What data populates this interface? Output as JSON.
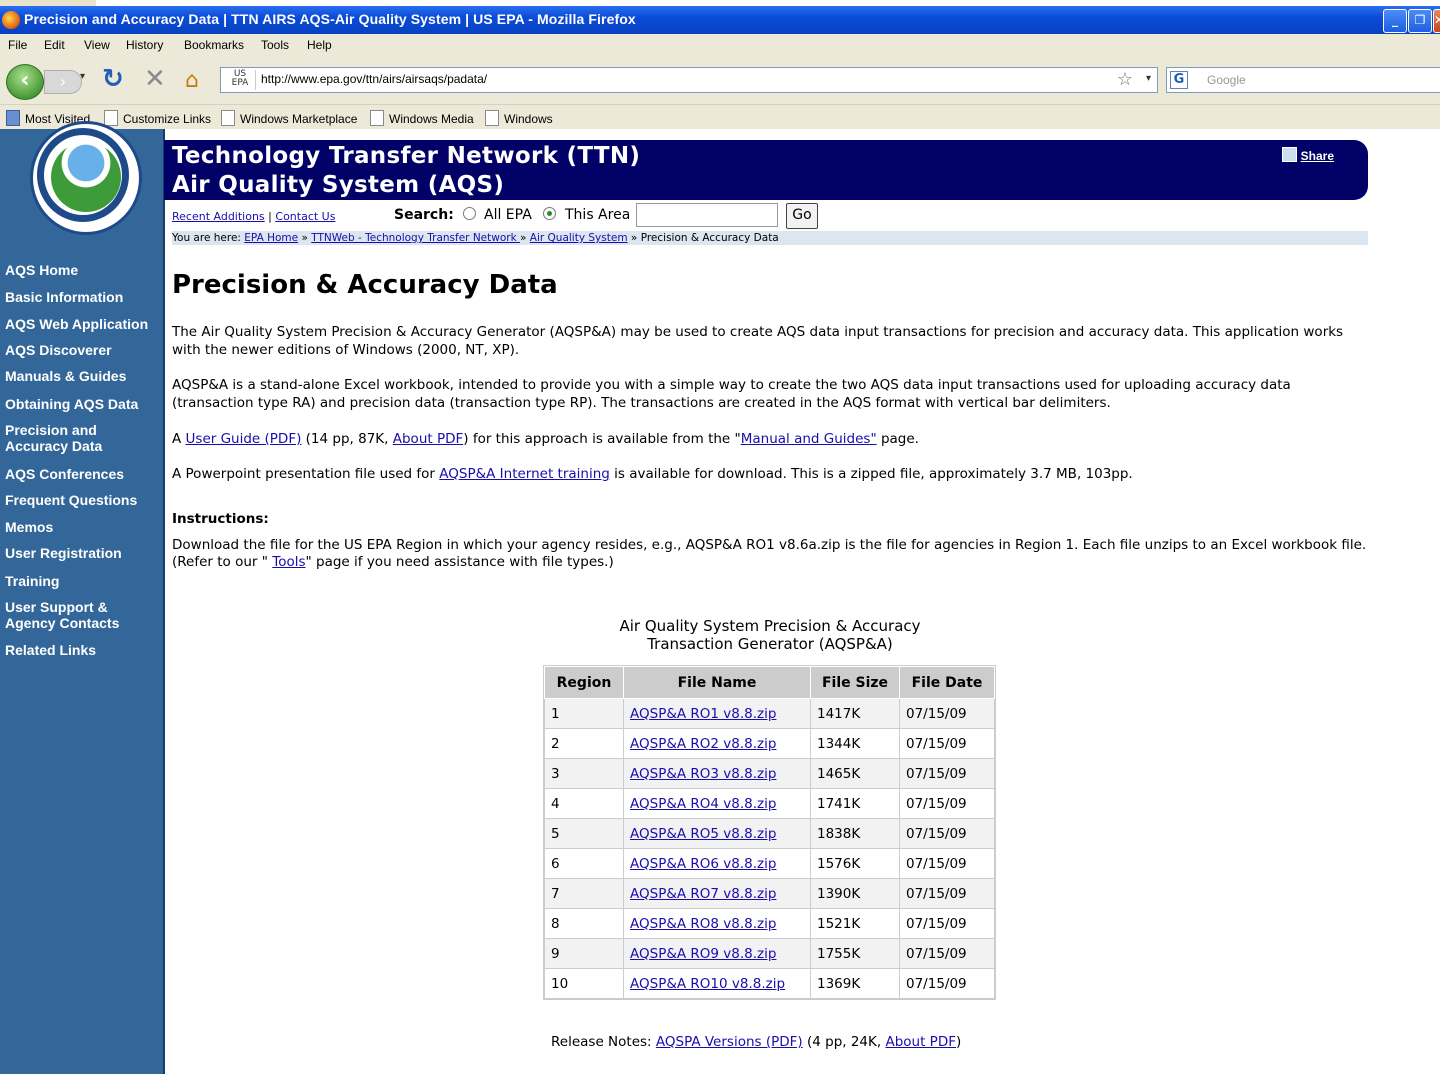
{
  "window": {
    "title": "Precision and Accuracy Data | TTN AIRS AQS-Air Quality System | US EPA - Mozilla Firefox",
    "buttons": [
      "_",
      "❐",
      "✕"
    ]
  },
  "menu": [
    "File",
    "Edit",
    "View",
    "History",
    "Bookmarks",
    "Tools",
    "Help"
  ],
  "nav": {
    "site_badge": "US EPA",
    "url": "http://www.epa.gov/ttn/airs/airsaqs/padata/",
    "search_placeholder": "Google"
  },
  "bookmarks": [
    "Most Visited",
    "Customize Links",
    "Windows Marketplace",
    "Windows Media",
    "Windows"
  ],
  "banner": {
    "line1": "Technology Transfer Network (TTN)",
    "line2": "Air Quality System (AQS)",
    "share": "Share"
  },
  "utility": {
    "recent_additions": "Recent Additions",
    "sep": "|",
    "contact_us": "Contact Us",
    "search_label": "Search:",
    "all_epa": "All EPA",
    "this_area": "This Area",
    "go": "Go"
  },
  "breadcrumb": {
    "prefix": "You are here:",
    "items": [
      "EPA Home",
      "TTNWeb - Technology Transfer Network ",
      "Air Quality System"
    ],
    "sep": "»",
    "current": "Precision & Accuracy Data"
  },
  "sidebar": {
    "items": [
      "AQS Home",
      "Basic Information",
      "AQS Web Application",
      "AQS Discoverer",
      "Manuals & Guides",
      "Obtaining AQS Data",
      "Precision and Accuracy Data",
      "AQS Conferences",
      "Frequent Questions",
      "Memos",
      "User Registration",
      "Training",
      "User Support & Agency Contacts",
      "Related Links"
    ]
  },
  "main": {
    "title": "Precision & Accuracy Data",
    "p1": "The Air Quality System Precision & Accuracy Generator (AQSP&A) may be used to create AQS data input transactions for precision and accuracy data. This application works with the newer editions of Windows (2000, NT, XP).",
    "p2": "AQSP&A is a stand-alone Excel workbook, intended to provide you with a simple way to create the two AQS data input transactions used for uploading accuracy data (transaction type RA) and precision data (transaction type RP). The transactions are created in the AQS format with vertical bar delimiters.",
    "p3": {
      "a": "A ",
      "link1": "User Guide (PDF)",
      "b": " (14 pp, 87K, ",
      "link2": "About PDF",
      "c": ") for this approach is available from the \"",
      "link3": "Manual and Guides\"",
      "d": " page."
    },
    "p4": {
      "a": "A Powerpoint presentation file used for ",
      "link": "AQSP&A Internet training",
      "b": " is available for download. This is a zipped file, approximately 3.7 MB, 103pp."
    },
    "instructions_heading": "Instructions:",
    "p5": {
      "a": "Download the file for the US EPA Region in which your agency resides, e.g., AQSP&A RO1 v8.6a.zip is the file for agencies in Region 1.  Each file unzips to an Excel workbook file.  (Refer to our \" ",
      "link": "Tools",
      "b": "\" page if you need assistance with file types.)"
    },
    "table_caption_line1": "Air Quality System Precision & Accuracy",
    "table_caption_line2": "Transaction Generator (AQSP&A)",
    "table": {
      "headers": [
        "Region",
        "File Name",
        "File Size",
        "File Date"
      ],
      "rows": [
        [
          "1",
          "AQSP&A RO1 v8.8.zip",
          "1417K",
          "07/15/09"
        ],
        [
          "2",
          "AQSP&A RO2 v8.8.zip",
          "1344K",
          "07/15/09"
        ],
        [
          "3",
          "AQSP&A RO3 v8.8.zip",
          "1465K",
          "07/15/09"
        ],
        [
          "4",
          "AQSP&A RO4 v8.8.zip",
          "1741K",
          "07/15/09"
        ],
        [
          "5",
          "AQSP&A RO5 v8.8.zip",
          "1838K",
          "07/15/09"
        ],
        [
          "6",
          "AQSP&A RO6 v8.8.zip",
          "1576K",
          "07/15/09"
        ],
        [
          "7",
          "AQSP&A RO7 v8.8.zip",
          "1390K",
          "07/15/09"
        ],
        [
          "8",
          "AQSP&A RO8 v8.8.zip",
          "1521K",
          "07/15/09"
        ],
        [
          "9",
          "AQSP&A RO9 v8.8.zip",
          "1755K",
          "07/15/09"
        ],
        [
          "10",
          "AQSP&A RO10 v8.8.zip",
          "1369K",
          "07/15/09"
        ]
      ]
    },
    "release": {
      "a": "Release Notes: ",
      "link1": "AQSPA Versions (PDF)",
      "b": " (4 pp, 24K, ",
      "link2": "About PDF",
      "c": ")"
    }
  },
  "colors": {
    "sidebar": "#336699",
    "banner": "#000066",
    "link": "#1a0dab",
    "titlebar": "#0a4bd8"
  }
}
